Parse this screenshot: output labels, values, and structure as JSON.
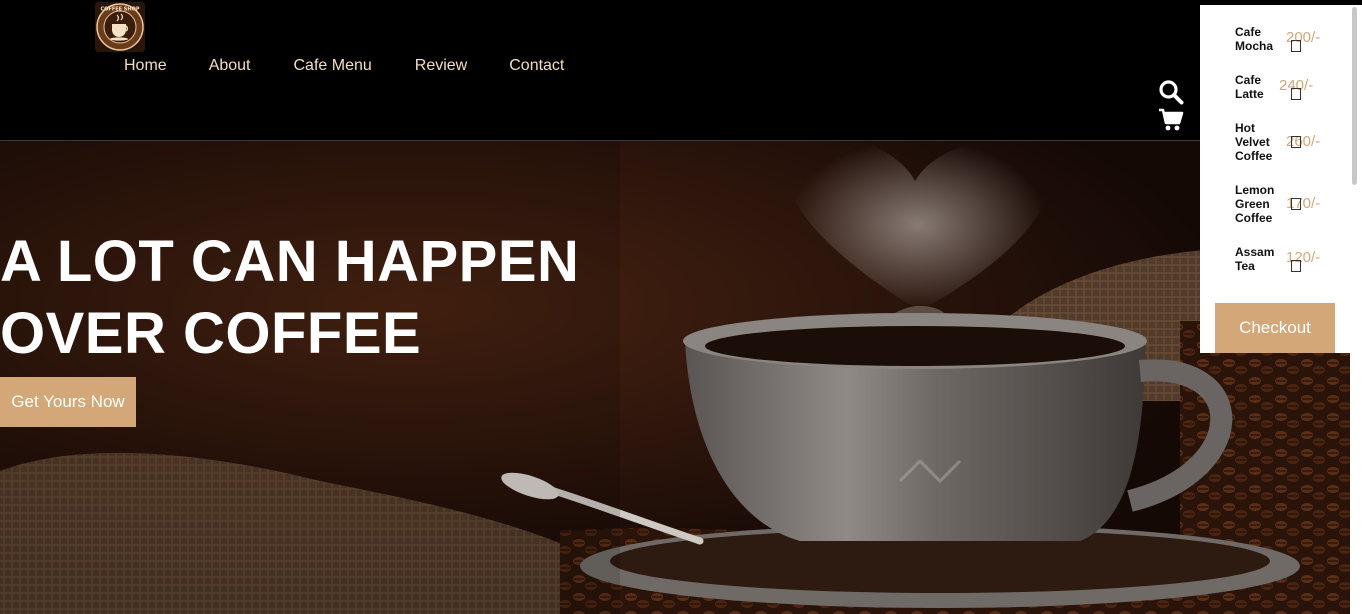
{
  "nav": {
    "items": [
      {
        "label": "Home"
      },
      {
        "label": "About"
      },
      {
        "label": "Cafe Menu"
      },
      {
        "label": "Review"
      },
      {
        "label": "Contact"
      }
    ]
  },
  "logo": {
    "text": "COFFEE SHOP"
  },
  "header_icons": [
    "search-icon",
    "cart-icon"
  ],
  "hero": {
    "title_line1": "A LOT CAN HAPPEN",
    "title_line2": "OVER COFFEE",
    "cta_label": "Get Yours Now"
  },
  "cart": {
    "items": [
      {
        "name": "Cafe Mocha",
        "price": "200/-"
      },
      {
        "name": "Cafe Latte",
        "price": "240/-"
      },
      {
        "name": "Hot Velvet Coffee",
        "price": "260/-"
      },
      {
        "name": "Lemon Green Coffee",
        "price": "170/-"
      },
      {
        "name": "Assam Tea",
        "price": "120/-"
      }
    ],
    "checkout_label": "Checkout"
  },
  "colors": {
    "accent": "#d3a777",
    "nav_text": "#f3dcc0",
    "header_bg": "#000000",
    "hero_bg": "#1b0d07"
  }
}
